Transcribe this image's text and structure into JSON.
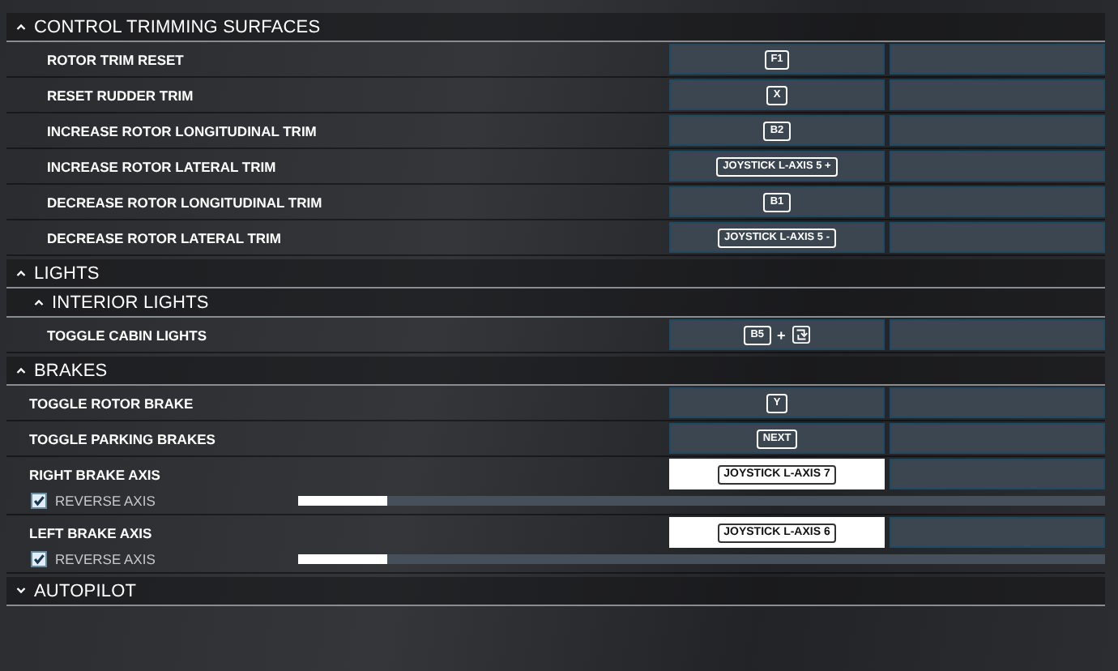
{
  "sections": [
    {
      "title": "CONTROL TRIMMING SURFACES",
      "expanded": true,
      "rows": [
        {
          "label": "ROTOR TRIM RESET",
          "binding": {
            "selected": false,
            "parts": [
              {
                "kind": "key",
                "text": "F1"
              }
            ]
          }
        },
        {
          "label": "RESET RUDDER TRIM",
          "binding": {
            "selected": false,
            "parts": [
              {
                "kind": "key",
                "text": "X"
              }
            ]
          }
        },
        {
          "label": "INCREASE ROTOR LONGITUDINAL TRIM",
          "binding": {
            "selected": false,
            "parts": [
              {
                "kind": "key",
                "text": "B2"
              }
            ]
          }
        },
        {
          "label": "INCREASE ROTOR LATERAL TRIM",
          "binding": {
            "selected": false,
            "parts": [
              {
                "kind": "key",
                "text": "JOYSTICK L-AXIS 5 +"
              }
            ]
          }
        },
        {
          "label": "DECREASE ROTOR LONGITUDINAL TRIM",
          "binding": {
            "selected": false,
            "parts": [
              {
                "kind": "key",
                "text": "B1"
              }
            ]
          }
        },
        {
          "label": "DECREASE ROTOR LATERAL TRIM",
          "binding": {
            "selected": false,
            "parts": [
              {
                "kind": "key",
                "text": "JOYSTICK L-AXIS 5 -"
              }
            ]
          }
        }
      ]
    },
    {
      "title": "LIGHTS",
      "expanded": true,
      "children": [
        {
          "title": "INTERIOR LIGHTS",
          "expanded": true,
          "rows": [
            {
              "label": "TOGGLE CABIN LIGHTS",
              "binding": {
                "selected": false,
                "parts": [
                  {
                    "kind": "key",
                    "text": "B5"
                  },
                  {
                    "kind": "sep",
                    "text": "+"
                  },
                  {
                    "kind": "icon"
                  }
                ]
              }
            }
          ]
        }
      ]
    },
    {
      "title": "BRAKES",
      "expanded": true,
      "rows": [
        {
          "label": "TOGGLE ROTOR BRAKE",
          "binding": {
            "selected": false,
            "parts": [
              {
                "kind": "key",
                "text": "Y"
              }
            ]
          }
        },
        {
          "label": "TOGGLE PARKING BRAKES",
          "binding": {
            "selected": false,
            "parts": [
              {
                "kind": "key",
                "text": "NEXT"
              }
            ]
          }
        },
        {
          "label": "RIGHT BRAKE AXIS",
          "binding": {
            "selected": true,
            "parts": [
              {
                "kind": "key",
                "text": "JOYSTICK L-AXIS 7"
              }
            ]
          },
          "axis": {
            "label": "REVERSE AXIS",
            "checked": true,
            "level": 0.11
          }
        },
        {
          "label": "LEFT BRAKE AXIS",
          "binding": {
            "selected": true,
            "parts": [
              {
                "kind": "key",
                "text": "JOYSTICK L-AXIS 6"
              }
            ]
          },
          "axis": {
            "label": "REVERSE AXIS",
            "checked": true,
            "level": 0.11
          }
        }
      ]
    },
    {
      "title": "AUTOPILOT",
      "expanded": false
    }
  ]
}
